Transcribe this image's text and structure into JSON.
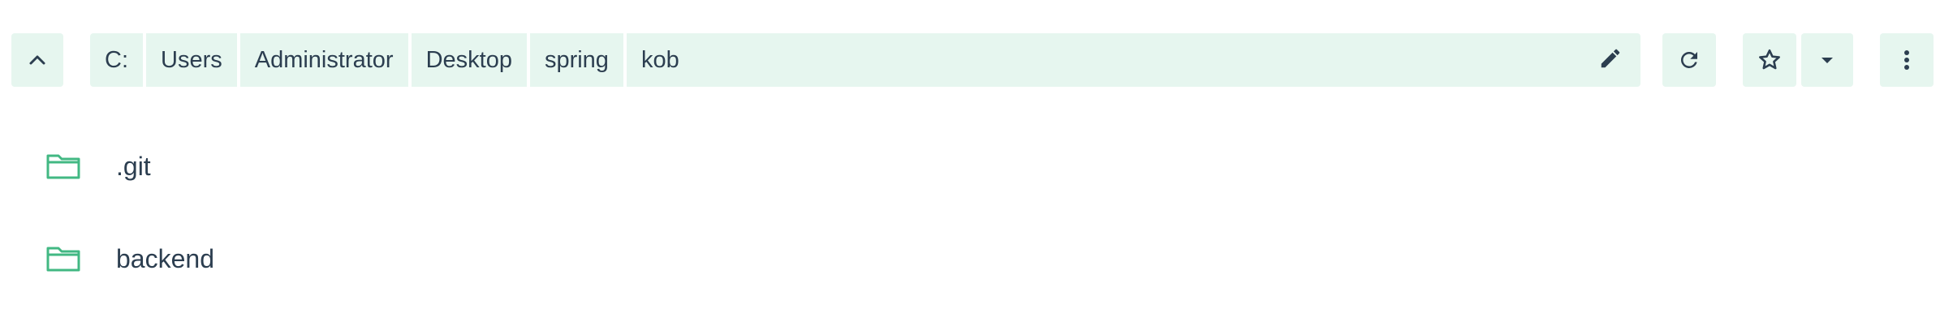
{
  "toolbar": {
    "up_icon": "chevron-up-icon",
    "breadcrumbs": [
      {
        "label": "C:"
      },
      {
        "label": "Users"
      },
      {
        "label": "Administrator"
      },
      {
        "label": "Desktop"
      },
      {
        "label": "spring"
      },
      {
        "label": "kob"
      }
    ],
    "edit_icon": "pencil-icon",
    "refresh_icon": "refresh-icon",
    "bookmark_icon": "star-icon",
    "bookmark_menu_icon": "caret-down-icon",
    "more_icon": "more-vertical-icon"
  },
  "files": [
    {
      "name": ".git",
      "icon": "folder-icon"
    },
    {
      "name": "backend",
      "icon": "folder-icon"
    }
  ],
  "colors": {
    "button_bg": "#e6f6ef",
    "folder": "#42b883",
    "text": "#2c3e50"
  }
}
